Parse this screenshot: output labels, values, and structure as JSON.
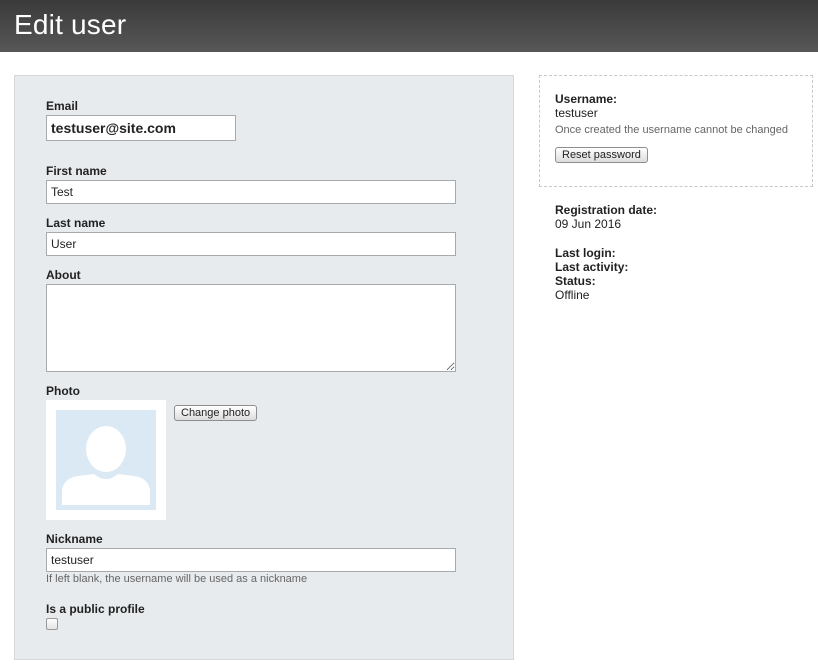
{
  "header": {
    "title": "Edit user"
  },
  "form": {
    "email": {
      "label": "Email",
      "value": "testuser@site.com"
    },
    "first_name": {
      "label": "First name",
      "value": "Test"
    },
    "last_name": {
      "label": "Last name",
      "value": "User"
    },
    "about": {
      "label": "About",
      "value": ""
    },
    "photo": {
      "label": "Photo",
      "change_button": "Change photo",
      "icon": "user-placeholder-icon"
    },
    "nickname": {
      "label": "Nickname",
      "value": "testuser",
      "hint": "If left blank, the username will be used as a nickname"
    },
    "public_profile": {
      "label": "Is a public profile",
      "checked": false
    }
  },
  "sidebar": {
    "username_label": "Username:",
    "username_value": "testuser",
    "username_note": "Once created the username cannot be changed",
    "reset_password_button": "Reset password",
    "registration_date_label": "Registration date:",
    "registration_date_value": "09 Jun 2016",
    "last_login_label": "Last login:",
    "last_activity_label": "Last activity:",
    "status_label": "Status:",
    "status_value": "Offline"
  },
  "colors": {
    "header_bg": "#4a4a4a",
    "panel_bg": "#e8ebee",
    "avatar_bg": "#dbe9f4"
  }
}
